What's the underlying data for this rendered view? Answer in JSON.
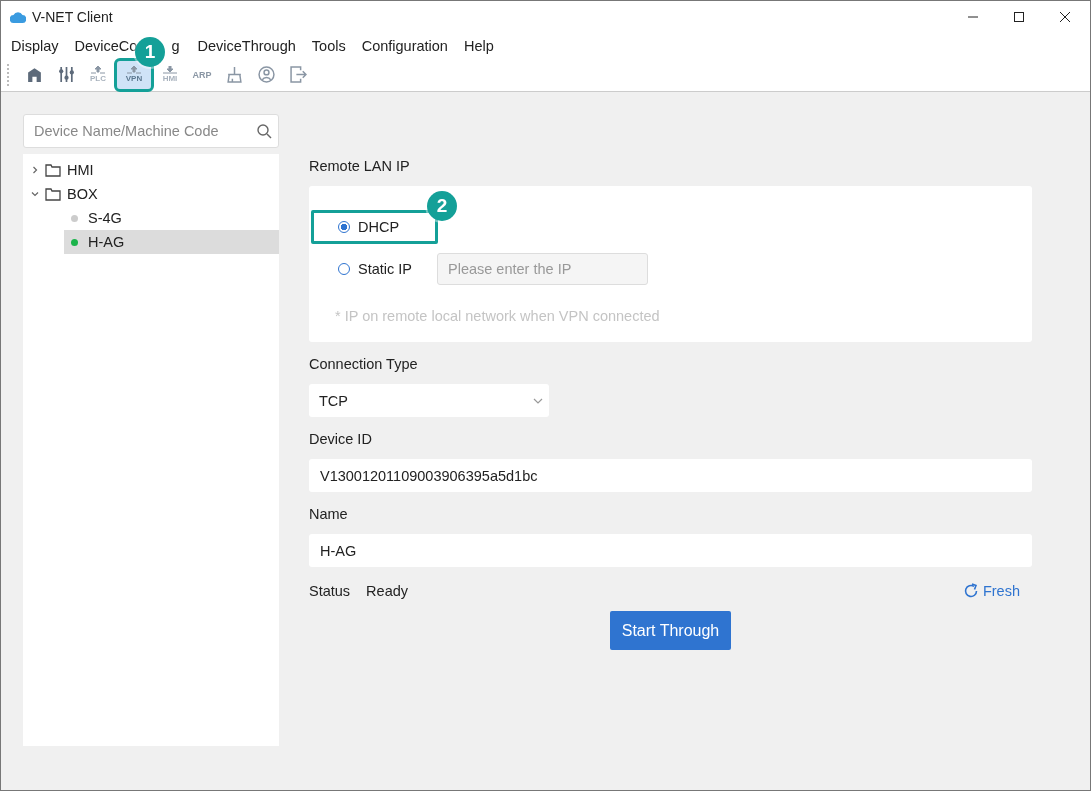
{
  "window": {
    "title": "V-NET Client"
  },
  "menu": [
    {
      "label": "Display"
    },
    {
      "label": "DeviceCo",
      "tail": "g"
    },
    {
      "label": "DeviceThrough"
    },
    {
      "label": "Tools"
    },
    {
      "label": "Configuration"
    },
    {
      "label": "Help"
    }
  ],
  "toolbar": [
    {
      "kind": "home",
      "selected": false
    },
    {
      "kind": "sliders",
      "selected": false
    },
    {
      "kind": "up",
      "label": "PLC",
      "selected": false
    },
    {
      "kind": "up",
      "label": "VPN",
      "selected": true,
      "badge": "1"
    },
    {
      "kind": "down",
      "label": "HMI",
      "selected": false
    },
    {
      "kind": "text",
      "label": "ARP",
      "selected": false
    },
    {
      "kind": "broom",
      "selected": false
    },
    {
      "kind": "user",
      "selected": false
    },
    {
      "kind": "exit",
      "selected": false
    }
  ],
  "search": {
    "placeholder": "Device Name/Machine Code"
  },
  "tree": [
    {
      "label": "HMI",
      "expanded": false
    },
    {
      "label": "BOX",
      "expanded": true,
      "children": [
        {
          "label": "S-4G",
          "color": "#cccccc",
          "selected": false
        },
        {
          "label": "H-AG",
          "color": "#1ab34a",
          "selected": true
        }
      ]
    }
  ],
  "remote_lan_ip": {
    "label": "Remote LAN IP",
    "options": [
      {
        "label": "DHCP",
        "selected": true,
        "badge": "2"
      },
      {
        "label": "Static IP",
        "selected": false
      }
    ],
    "ip_placeholder": "Please enter the IP",
    "note": "* IP on remote local network when VPN connected"
  },
  "connection_type": {
    "label": "Connection Type",
    "value": "TCP"
  },
  "device_id": {
    "label": "Device ID",
    "value": "V13001201109003906395a5d1bc"
  },
  "name": {
    "label": "Name",
    "value": "H-AG"
  },
  "status": {
    "label": "Status",
    "value": "Ready"
  },
  "refresh": "Fresh",
  "start_button": "Start Through"
}
